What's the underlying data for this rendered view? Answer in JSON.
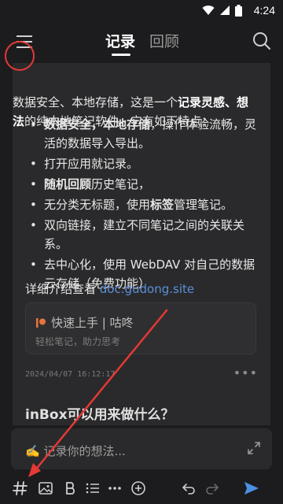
{
  "status": {
    "time": "4:24"
  },
  "header": {
    "tabs": [
      {
        "label": "记录"
      },
      {
        "label": "回顾"
      }
    ]
  },
  "card1": {
    "intro_parts": [
      "数据安全、本地存储，这是一个",
      "记录灵感、想法",
      "的纯本地笔记软件。它有如下特点："
    ],
    "features": [
      {
        "bold": "数据安全，本地存储",
        "rest": "，操作体验流畅，灵活的数据导入导出。"
      },
      {
        "bold": "",
        "rest": "打开应用就记录。"
      },
      {
        "bold": "随机回顾",
        "rest": "历史笔记，"
      },
      {
        "pre": "无分类无标题，使用",
        "bold": "标签",
        "rest": "管理笔记。"
      },
      {
        "bold": "",
        "rest": "双向链接，建立不同笔记之间的关联关系。"
      },
      {
        "bold": "",
        "rest": "去中心化，使用 WebDAV 对自己的数据云存储（免费功能）"
      }
    ],
    "more_text": "详细介绍查看 ",
    "more_link": "doc.gudong.site",
    "link_card": {
      "title": "快速上手 | 咕咚",
      "subtitle": "轻松笔记，助力思考"
    },
    "timestamp": "2024/04/07 16:12:17",
    "more_dots": "•••"
  },
  "card2": {
    "title": "inBox可以用来做什么？"
  },
  "composer": {
    "placeholder": "✍️ 记录你的想法..."
  },
  "colors": {
    "annotation": "#e53935",
    "link": "#5b8fd9",
    "send": "#4a90e2"
  }
}
